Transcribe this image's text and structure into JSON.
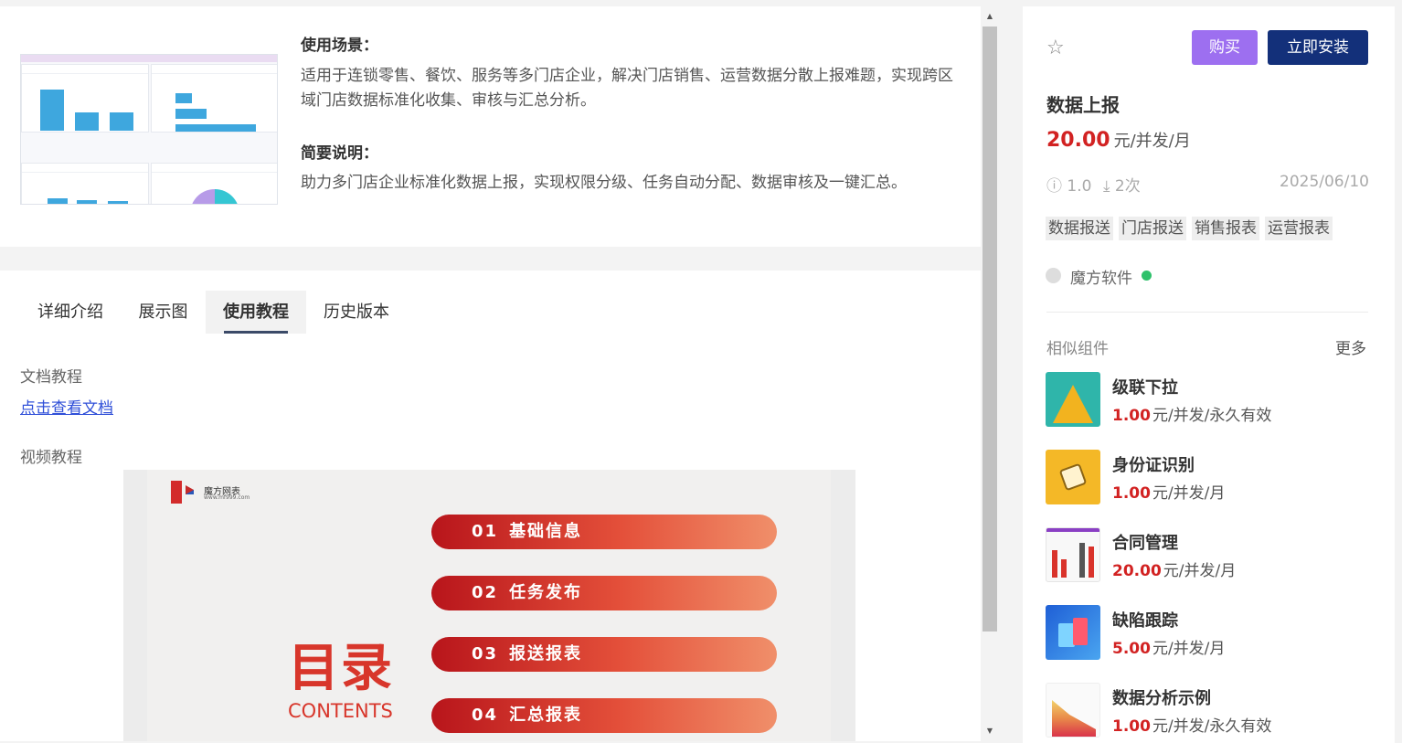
{
  "description": {
    "scenario_title": "使用场景：",
    "scenario_text": "适用于连锁零售、餐饮、服务等多门店企业，解决门店销售、运营数据分散上报难题，实现跨区域门店数据标准化收集、审核与汇总分析。",
    "summary_title": "简要说明：",
    "summary_text": "助力多门店企业标准化数据上报，实现权限分级、任务自动分配、数据审核及一键汇总。"
  },
  "tabs": [
    {
      "label": "详细介绍",
      "active": false
    },
    {
      "label": "展示图",
      "active": false
    },
    {
      "label": "使用教程",
      "active": true
    },
    {
      "label": "历史版本",
      "active": false
    }
  ],
  "tutorial": {
    "doc_label": "文档教程",
    "doc_link": "点击查看文档",
    "video_label": "视频教程"
  },
  "video": {
    "brand": "魔方网表",
    "brand_url": "www.mf999.com",
    "big_title": "目录",
    "contents": "CONTENTS",
    "items": [
      {
        "num": "01",
        "label": "基础信息"
      },
      {
        "num": "02",
        "label": "任务发布"
      },
      {
        "num": "03",
        "label": "报送报表"
      },
      {
        "num": "04",
        "label": "汇总报表"
      }
    ]
  },
  "product": {
    "buy_label": "购买",
    "install_label": "立即安装",
    "title": "数据上报",
    "price": "20.00",
    "price_unit": "元/并发/月",
    "version": "1.0",
    "downloads": "2次",
    "date": "2025/06/10",
    "tags": [
      "数据报送",
      "门店报送",
      "销售报表",
      "运营报表"
    ],
    "author": "魔方软件"
  },
  "similar": {
    "title": "相似组件",
    "more": "更多",
    "items": [
      {
        "name": "级联下拉",
        "price": "1.00",
        "unit": "元/并发/永久有效"
      },
      {
        "name": "身份证识别",
        "price": "1.00",
        "unit": "元/并发/月"
      },
      {
        "name": "合同管理",
        "price": "20.00",
        "unit": "元/并发/月"
      },
      {
        "name": "缺陷跟踪",
        "price": "5.00",
        "unit": "元/并发/月"
      },
      {
        "name": "数据分析示例",
        "price": "1.00",
        "unit": "元/并发/永久有效"
      }
    ]
  },
  "colors": {
    "price_red": "#d22222",
    "buy_purple": "#9d6ff0",
    "install_navy": "#13307a",
    "link_blue": "#2f4fd8",
    "chart_blue": "#3ea7de"
  }
}
